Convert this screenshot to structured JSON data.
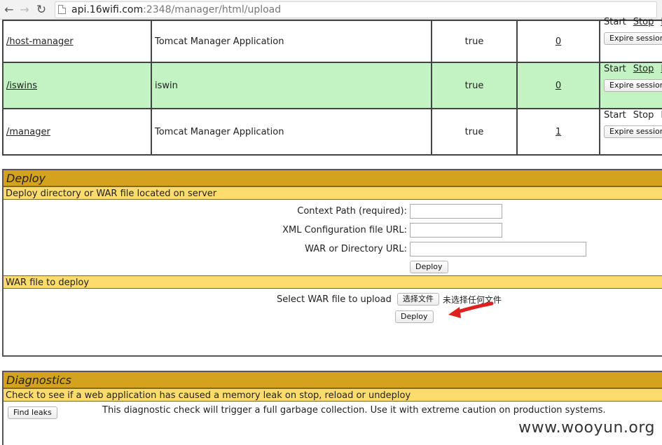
{
  "browser": {
    "url_host": "api.16wifi.com",
    "url_path": ":2348/manager/html/upload"
  },
  "applications": [
    {
      "path": "/host-manager",
      "name": "Tomcat Manager Application",
      "running": "true",
      "sessions": "0",
      "highlight": false
    },
    {
      "path": "/iswins",
      "name": "iswin",
      "running": "true",
      "sessions": "0",
      "highlight": true
    },
    {
      "path": "/manager",
      "name": "Tomcat Manager Application",
      "running": "true",
      "sessions": "1",
      "highlight": false
    }
  ],
  "commands": {
    "start": "Start",
    "stop": "Stop",
    "reload_partial": "R",
    "expire": "Expire session"
  },
  "deploy": {
    "title": "Deploy",
    "server_subtitle": "Deploy directory or WAR file located on server",
    "context_path_label": "Context Path (required):",
    "xml_config_label": "XML Configuration file URL:",
    "war_dir_label": "WAR or Directory URL:",
    "deploy_button": "Deploy",
    "war_subtitle": "WAR file to deploy",
    "select_war_label": "Select WAR file to upload",
    "choose_file_button": "选择文件",
    "no_file_text": "未选择任何文件",
    "upload_deploy_button": "Deploy"
  },
  "diagnostics": {
    "title": "Diagnostics",
    "subtitle": "Check to see if a web application has caused a memory leak on stop, reload or undeploy",
    "find_leaks_button": "Find leaks",
    "description": "This diagnostic check will trigger a full garbage collection. Use it with extreme caution on production systems."
  },
  "watermark": "www.wooyun.org",
  "colors": {
    "section_title_bg": "#d4a21c",
    "section_sub_bg": "#fedb6d",
    "row_highlight": "#c3f2c3",
    "arrow": "#e02020"
  }
}
